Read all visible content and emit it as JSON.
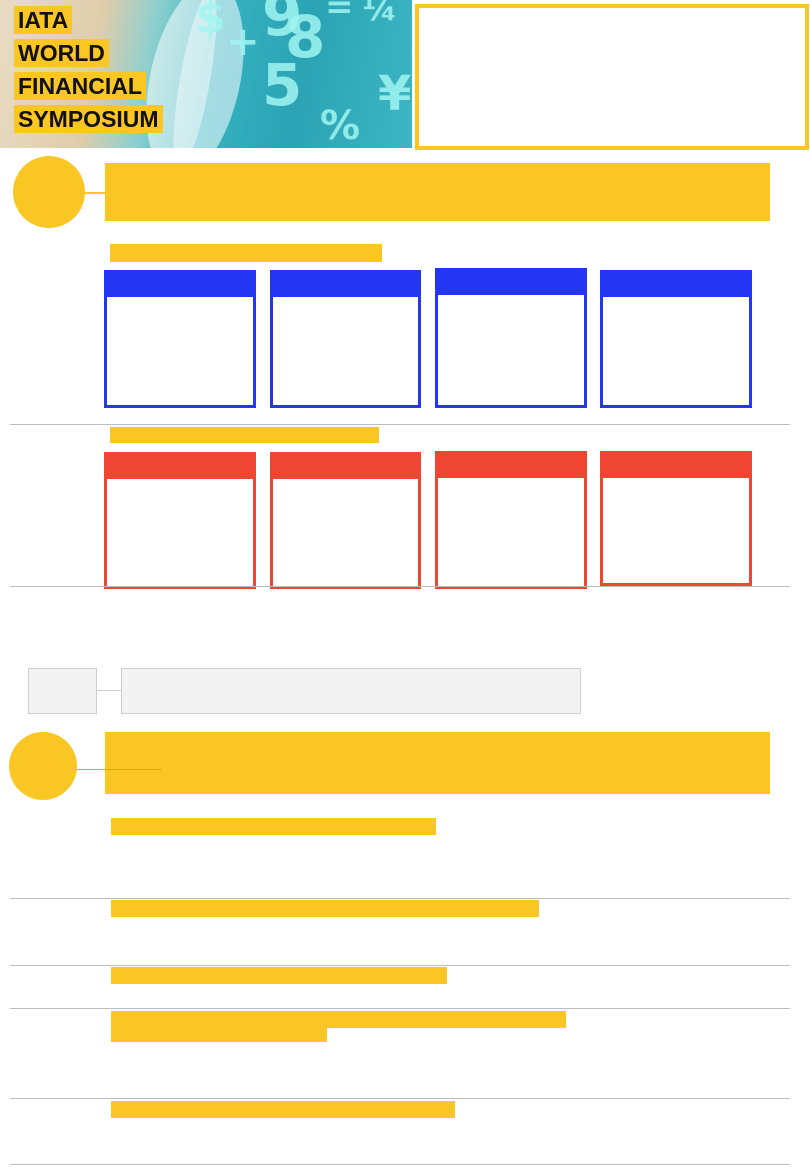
{
  "banner": {
    "title_lines": [
      "IATA",
      "WORLD",
      "FINANCIAL",
      "SYMPOSIUM"
    ],
    "glyphs": [
      "$",
      "9",
      "8",
      "=",
      "¼",
      "+",
      "5",
      "¥",
      "%"
    ]
  },
  "colors": {
    "accent_yellow": "#f9c623",
    "blue": "#2535f4",
    "red": "#ee4632",
    "rule_gray": "#bdbdbd"
  }
}
